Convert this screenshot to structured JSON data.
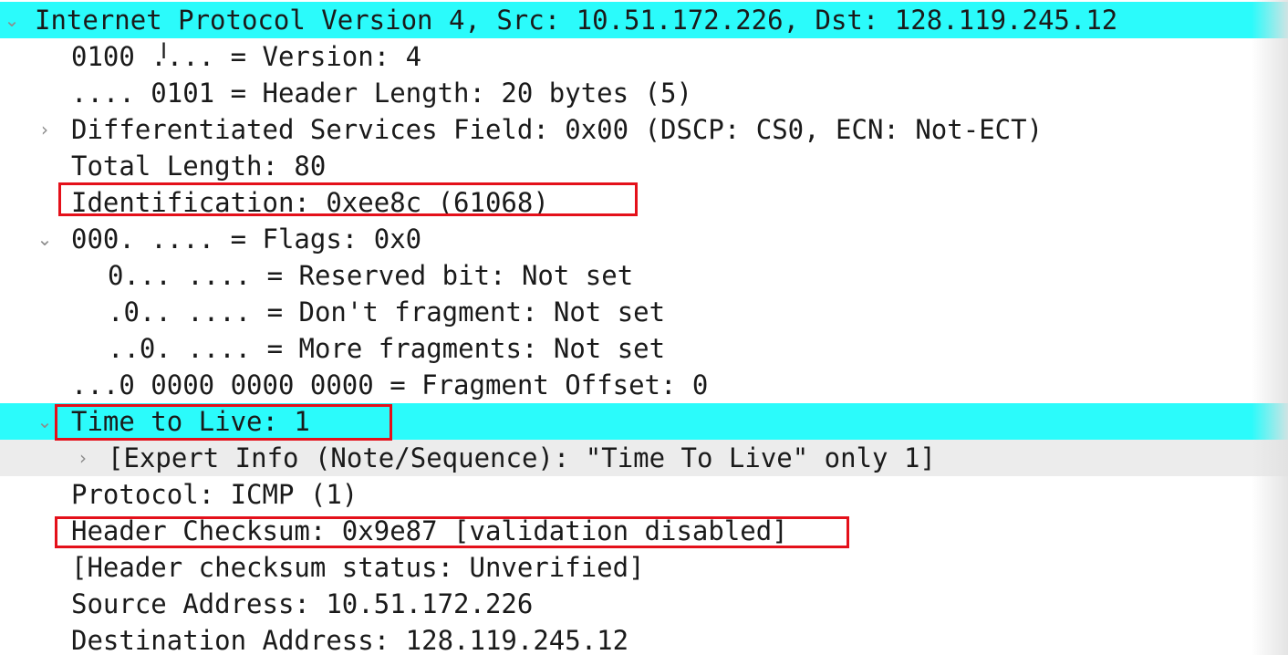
{
  "packet_details": {
    "rows": [
      {
        "text": "Internet Protocol Version 4, Src: 10.51.172.226, Dst: 128.119.245.12",
        "arrow": "expanded",
        "highlighted": true
      },
      {
        "text": "0100 .... = Version: 4"
      },
      {
        "text": ".... 0101 = Header Length: 20 bytes (5)"
      },
      {
        "text": "Differentiated Services Field: 0x00 (DSCP: CS0, ECN: Not-ECT)",
        "arrow": "collapsed"
      },
      {
        "text": "Total Length: 80"
      },
      {
        "text": "Identification: 0xee8c (61068)",
        "boxed": true
      },
      {
        "text": "000. .... = Flags: 0x0",
        "arrow": "expanded"
      },
      {
        "text": "0... .... = Reserved bit: Not set"
      },
      {
        "text": ".0.. .... = Don't fragment: Not set"
      },
      {
        "text": "..0. .... = More fragments: Not set"
      },
      {
        "text": "...0 0000 0000 0000 = Fragment Offset: 0"
      },
      {
        "text": "Time to Live: 1",
        "arrow": "expanded",
        "highlighted": true,
        "boxed": true
      },
      {
        "text": "[Expert Info (Note/Sequence): \"Time To Live\" only 1]",
        "arrow": "collapsed"
      },
      {
        "text": "Protocol: ICMP (1)"
      },
      {
        "text": "Header Checksum: 0x9e87 [validation disabled]",
        "boxed": true
      },
      {
        "text": "[Header checksum status: Unverified]"
      },
      {
        "text": "Source Address: 10.51.172.226"
      },
      {
        "text": "Destination Address: 128.119.245.12"
      }
    ]
  },
  "icons": {
    "expanded": "chevron-down-icon",
    "collapsed": "chevron-right-icon",
    "cursor": "text-cursor-icon"
  },
  "colors": {
    "selection_highlight": "#2bfbfb",
    "annotation_box": "#e4101a",
    "expert_info_background": "#ececec"
  }
}
